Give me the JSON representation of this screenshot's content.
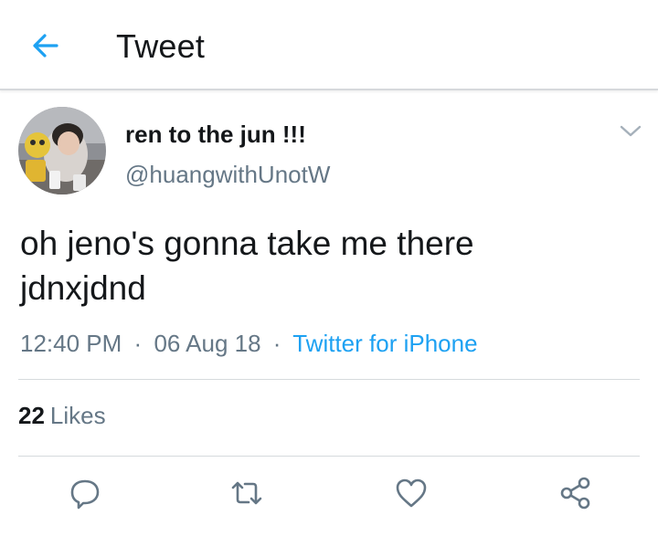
{
  "header": {
    "title": "Tweet",
    "back_icon": "arrow-left-icon"
  },
  "tweet": {
    "display_name": "ren to the jun !!!",
    "handle": "@huangwithUnotW",
    "text_lines": [
      "oh jeno's gonna take me there",
      "jdnxjdnd"
    ],
    "time": "12:40 PM",
    "date": "06 Aug 18",
    "source": "Twitter for iPhone",
    "separator": "·",
    "likes_count": "22",
    "likes_label": "Likes"
  },
  "actions": [
    {
      "name": "reply",
      "icon": "reply-icon"
    },
    {
      "name": "retweet",
      "icon": "retweet-icon"
    },
    {
      "name": "like",
      "icon": "heart-icon"
    },
    {
      "name": "share",
      "icon": "share-icon"
    }
  ],
  "colors": {
    "accent": "#1da1f2",
    "text": "#14171a",
    "secondary_text": "#657786",
    "divider": "#d6dadd"
  }
}
